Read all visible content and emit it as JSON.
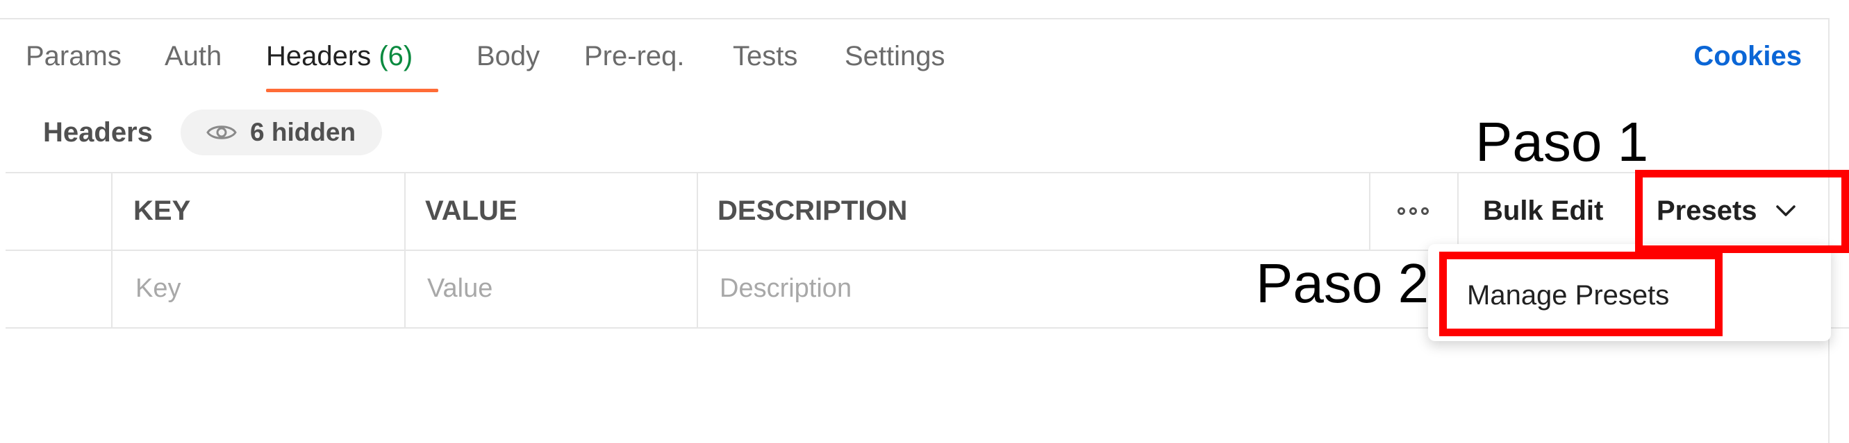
{
  "tabs": {
    "items": [
      {
        "label": "Params"
      },
      {
        "label": "Auth"
      },
      {
        "label": "Headers",
        "count": "(6)"
      },
      {
        "label": "Body"
      },
      {
        "label": "Pre-req."
      },
      {
        "label": "Tests"
      },
      {
        "label": "Settings"
      }
    ],
    "active_index": 2,
    "cookies_label": "Cookies"
  },
  "headers_section": {
    "title": "Headers",
    "hidden_label": "6 hidden",
    "hidden_icon": "eye-icon"
  },
  "table": {
    "columns": [
      "KEY",
      "VALUE",
      "DESCRIPTION"
    ],
    "placeholders": [
      "Key",
      "Value",
      "Description"
    ],
    "more_icon": "more-horizontal-icon",
    "bulk_edit_label": "Bulk Edit",
    "presets_label": "Presets",
    "presets_icon": "chevron-down-icon"
  },
  "presets_menu": {
    "items": [
      "Manage Presets"
    ]
  },
  "annotations": {
    "step1": "Paso 1",
    "step2": "Paso 2",
    "color": "#ff0000"
  },
  "colors": {
    "active_tab_underline": "#ff6c37",
    "count": "#0a8a3f",
    "link": "#0b66d6"
  }
}
